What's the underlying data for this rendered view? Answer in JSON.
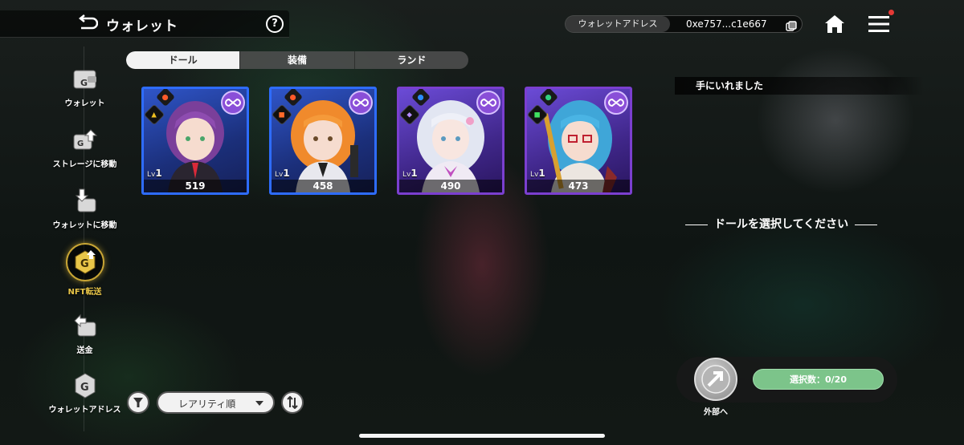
{
  "header": {
    "title": "ウォレット",
    "help_label": "?",
    "address_label": "ウォレットアドレス",
    "address_value": "0xe757...c1e667"
  },
  "sidebar": {
    "items": [
      {
        "label": "ウォレット",
        "icon": "wallet-icon"
      },
      {
        "label": "ストレージに移動",
        "icon": "storage-transfer-icon"
      },
      {
        "label": "ウォレットに移動",
        "icon": "wallet-transfer-icon"
      },
      {
        "label": "NFT転送",
        "icon": "nft-transfer-icon",
        "active": true
      },
      {
        "label": "送金",
        "icon": "remit-icon"
      },
      {
        "label": "ウォレットアドレス",
        "icon": "wallet-address-icon"
      }
    ]
  },
  "tabs": [
    {
      "label": "ドール",
      "active": true
    },
    {
      "label": "装備",
      "active": false
    },
    {
      "label": "ランド",
      "active": false
    }
  ],
  "cards": [
    {
      "level_prefix": "Lv",
      "level": "1",
      "power": "519",
      "rarity_color": "blue",
      "attribute": "fire"
    },
    {
      "level_prefix": "Lv",
      "level": "1",
      "power": "458",
      "rarity_color": "blue",
      "attribute": "fire"
    },
    {
      "level_prefix": "Lv",
      "level": "1",
      "power": "490",
      "rarity_color": "purple",
      "attribute": "water"
    },
    {
      "level_prefix": "Lv",
      "level": "1",
      "power": "473",
      "rarity_color": "purple",
      "attribute": "wind"
    }
  ],
  "right_panel": {
    "obtained_label": "手にいれました",
    "select_prompt": "ドールを選択してください"
  },
  "bottom": {
    "external_label": "外部へ",
    "selection_count": "選択数：0/20",
    "sort_label": "レアリティ順"
  },
  "colors": {
    "accent_gold": "#c8a535",
    "card_blue": "#2e6cff",
    "card_purple": "#7b3fd0",
    "count_green": "#7cc48a"
  }
}
